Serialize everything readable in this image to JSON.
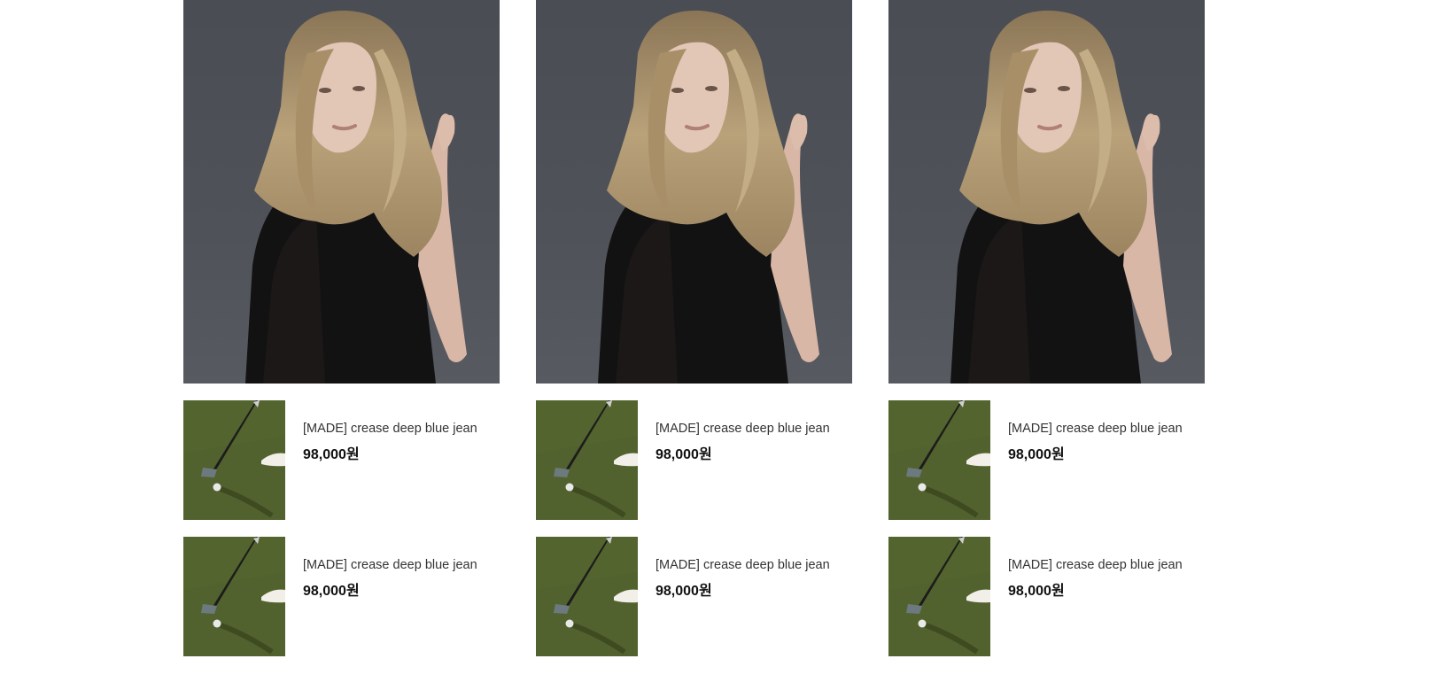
{
  "columns": [
    {
      "hero_image": "model-portrait-photo",
      "products": [
        {
          "name": "[MADE] crease deep blue jean",
          "price": "98,000원",
          "thumbnail": "golf-putt-photo"
        },
        {
          "name": "[MADE] crease deep blue jean",
          "price": "98,000원",
          "thumbnail": "golf-putt-photo"
        }
      ]
    },
    {
      "hero_image": "model-portrait-photo",
      "products": [
        {
          "name": "[MADE] crease deep blue jean",
          "price": "98,000원",
          "thumbnail": "golf-putt-photo"
        },
        {
          "name": "[MADE] crease deep blue jean",
          "price": "98,000원",
          "thumbnail": "golf-putt-photo"
        }
      ]
    },
    {
      "hero_image": "model-portrait-photo",
      "products": [
        {
          "name": "[MADE] crease deep blue jean",
          "price": "98,000원",
          "thumbnail": "golf-putt-photo"
        },
        {
          "name": "[MADE] crease deep blue jean",
          "price": "98,000원",
          "thumbnail": "golf-putt-photo"
        }
      ]
    }
  ],
  "colors": {
    "photo_background": "#4f5259",
    "grass": "#4a5a28",
    "name_text": "#333333",
    "price_text": "#111111"
  }
}
